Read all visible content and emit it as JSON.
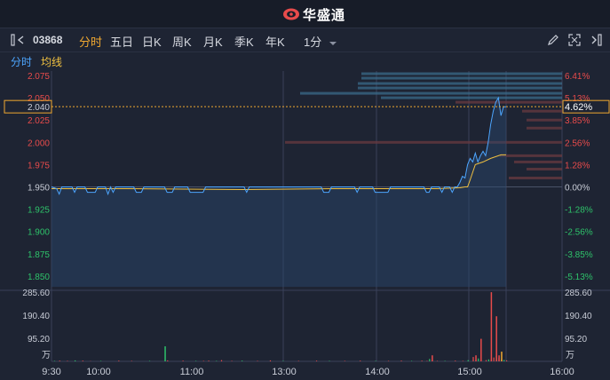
{
  "brand": {
    "name": "华盛通"
  },
  "toolbar": {
    "code": "03868",
    "tabs": [
      "分时",
      "五日",
      "日K",
      "周K",
      "月K",
      "季K",
      "年K"
    ],
    "active_tab": "分时",
    "interval": "1分"
  },
  "subtabs": {
    "line": "分时",
    "avg": "均线"
  },
  "colors": {
    "up": "#e84b4b",
    "down": "#2ec26a",
    "price_line": "#4da6ff",
    "avg_line": "#f0c040",
    "accent": "#f0a830"
  },
  "chart_data": {
    "type": "line",
    "price_axis": [
      "2.075",
      "2.050",
      "2.025",
      "2.000",
      "1.975",
      "1.950",
      "1.925",
      "1.900",
      "1.875",
      "1.850"
    ],
    "pct_axis": [
      "6.41%",
      "5.13%",
      "3.85%",
      "2.56%",
      "1.28%",
      "0.00%",
      "-1.28%",
      "-2.56%",
      "-3.85%",
      "-5.13%"
    ],
    "current_price": "2.040",
    "current_pct": "4.62%",
    "volume_axis": [
      "285.60",
      "190.40",
      "95.20"
    ],
    "volume_unit": "万",
    "time_labels": [
      "9:30",
      "10:00",
      "11:00",
      "13:00",
      "14:00",
      "15:00",
      "16:00"
    ],
    "prev_close": 1.95,
    "ylim": [
      1.838,
      2.08
    ],
    "price_series": [
      [
        0,
        1.95
      ],
      [
        4,
        1.948
      ],
      [
        6,
        1.942
      ],
      [
        8,
        1.95
      ],
      [
        16,
        1.95
      ],
      [
        18,
        1.944
      ],
      [
        20,
        1.95
      ],
      [
        26,
        1.95
      ],
      [
        28,
        1.944
      ],
      [
        34,
        1.944
      ],
      [
        36,
        1.95
      ],
      [
        42,
        1.95
      ],
      [
        44,
        1.942
      ],
      [
        46,
        1.95
      ],
      [
        48,
        1.944
      ],
      [
        50,
        1.95
      ],
      [
        64,
        1.95
      ],
      [
        66,
        1.944
      ],
      [
        70,
        1.944
      ],
      [
        72,
        1.95
      ],
      [
        88,
        1.95
      ],
      [
        90,
        1.944
      ],
      [
        94,
        1.944
      ],
      [
        96,
        1.95
      ],
      [
        106,
        1.95
      ],
      [
        108,
        1.944
      ],
      [
        118,
        1.944
      ],
      [
        120,
        1.95
      ],
      [
        150,
        1.95
      ],
      [
        152,
        1.944
      ],
      [
        154,
        1.95
      ],
      [
        210,
        1.95
      ],
      [
        212,
        1.944
      ],
      [
        216,
        1.944
      ],
      [
        218,
        1.95
      ],
      [
        236,
        1.95
      ],
      [
        238,
        1.944
      ],
      [
        240,
        1.95
      ],
      [
        250,
        1.95
      ],
      [
        252,
        1.944
      ],
      [
        262,
        1.944
      ],
      [
        264,
        1.95
      ],
      [
        290,
        1.95
      ],
      [
        292,
        1.944
      ],
      [
        294,
        1.944
      ],
      [
        296,
        1.95
      ],
      [
        302,
        1.95
      ],
      [
        304,
        1.944
      ],
      [
        306,
        1.95
      ],
      [
        310,
        1.95
      ],
      [
        312,
        1.944
      ],
      [
        314,
        1.95
      ],
      [
        316,
        1.95
      ],
      [
        318,
        1.955
      ],
      [
        320,
        1.962
      ],
      [
        322,
        1.96
      ],
      [
        324,
        1.975
      ],
      [
        326,
        1.982
      ],
      [
        328,
        1.978
      ],
      [
        330,
        1.988
      ],
      [
        332,
        1.978
      ],
      [
        334,
        1.985
      ],
      [
        336,
        1.99
      ],
      [
        338,
        1.985
      ],
      [
        340,
        2.0
      ],
      [
        342,
        2.02
      ],
      [
        344,
        2.035
      ],
      [
        346,
        2.045
      ],
      [
        348,
        2.05
      ],
      [
        350,
        2.03
      ],
      [
        352,
        2.04
      ],
      [
        354,
        2.04
      ]
    ],
    "avg_series": [
      [
        0,
        1.948
      ],
      [
        60,
        1.948
      ],
      [
        150,
        1.947
      ],
      [
        220,
        1.948
      ],
      [
        300,
        1.948
      ],
      [
        318,
        1.949
      ],
      [
        322,
        1.95
      ],
      [
        324,
        1.95
      ],
      [
        326,
        1.958
      ],
      [
        330,
        1.975
      ],
      [
        336,
        1.978
      ],
      [
        342,
        1.982
      ],
      [
        350,
        1.986
      ],
      [
        354,
        1.986
      ]
    ],
    "volume_series": [
      [
        2,
        2
      ],
      [
        6,
        3
      ],
      [
        12,
        2
      ],
      [
        18,
        4
      ],
      [
        24,
        3
      ],
      [
        30,
        1
      ],
      [
        38,
        2
      ],
      [
        52,
        3
      ],
      [
        62,
        2
      ],
      [
        76,
        2
      ],
      [
        90,
        4
      ],
      [
        102,
        3
      ],
      [
        112,
        2
      ],
      [
        118,
        2
      ],
      [
        122,
        3
      ],
      [
        128,
        2
      ],
      [
        132,
        5
      ],
      [
        140,
        2
      ],
      [
        148,
        3
      ],
      [
        160,
        2
      ],
      [
        170,
        4
      ],
      [
        180,
        2
      ],
      [
        192,
        2
      ],
      [
        206,
        3
      ],
      [
        216,
        2
      ],
      [
        228,
        2
      ],
      [
        240,
        3
      ],
      [
        252,
        2
      ],
      [
        262,
        2
      ],
      [
        272,
        3
      ],
      [
        280,
        2
      ],
      [
        288,
        3
      ],
      [
        292,
        2
      ],
      [
        294,
        10
      ],
      [
        296,
        4
      ],
      [
        300,
        2
      ],
      [
        306,
        2
      ],
      [
        314,
        3
      ],
      [
        320,
        2
      ],
      [
        324,
        5
      ],
      [
        328,
        18
      ],
      [
        330,
        4
      ],
      [
        332,
        12
      ],
      [
        334,
        3
      ],
      [
        338,
        5
      ],
      [
        340,
        8
      ],
      [
        342,
        8
      ],
      [
        344,
        16
      ],
      [
        346,
        22
      ],
      [
        348,
        14
      ],
      [
        350,
        10
      ],
      [
        352,
        6
      ],
      [
        354,
        4
      ]
    ],
    "volume_big": [
      [
        296,
        8
      ],
      [
        330,
        8
      ],
      [
        334,
        30
      ],
      [
        342,
        92
      ],
      [
        346,
        60
      ],
      [
        348,
        8
      ]
    ]
  }
}
